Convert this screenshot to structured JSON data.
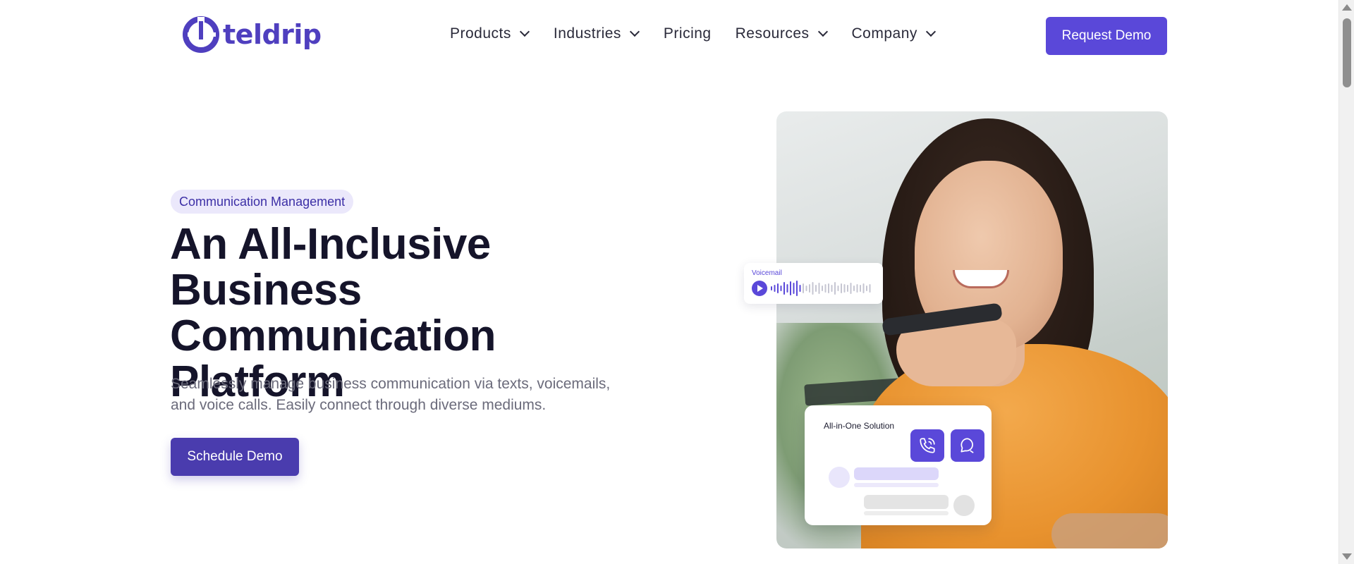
{
  "brand": {
    "name": "teldrip",
    "color": "#4f3fbf"
  },
  "nav": {
    "items": [
      {
        "label": "Products",
        "has_dropdown": true
      },
      {
        "label": "Industries",
        "has_dropdown": true
      },
      {
        "label": "Pricing",
        "has_dropdown": false
      },
      {
        "label": "Resources",
        "has_dropdown": true
      },
      {
        "label": "Company",
        "has_dropdown": true
      }
    ],
    "cta_label": "Request Demo"
  },
  "hero": {
    "badge": "Communication Management",
    "headline_lines": [
      "An All-Inclusive Business",
      "Communication",
      "Platform"
    ],
    "subtext_lines": [
      "Seamlessly manage business communication via texts, voicemails,",
      "and voice calls. Easily connect through diverse mediums."
    ],
    "cta_label": "Schedule Demo"
  },
  "image_overlays": {
    "voicemail_label": "Voicemail",
    "aio_title": "All-in-One Solution",
    "icons": [
      "phone-call-icon",
      "chat-bubble-icon"
    ]
  },
  "colors": {
    "accent": "#5a48d9",
    "accent_dark": "#4a3cae",
    "badge_bg": "#ebe8fb",
    "text": "#15142a",
    "muted": "#6b6b7b"
  }
}
